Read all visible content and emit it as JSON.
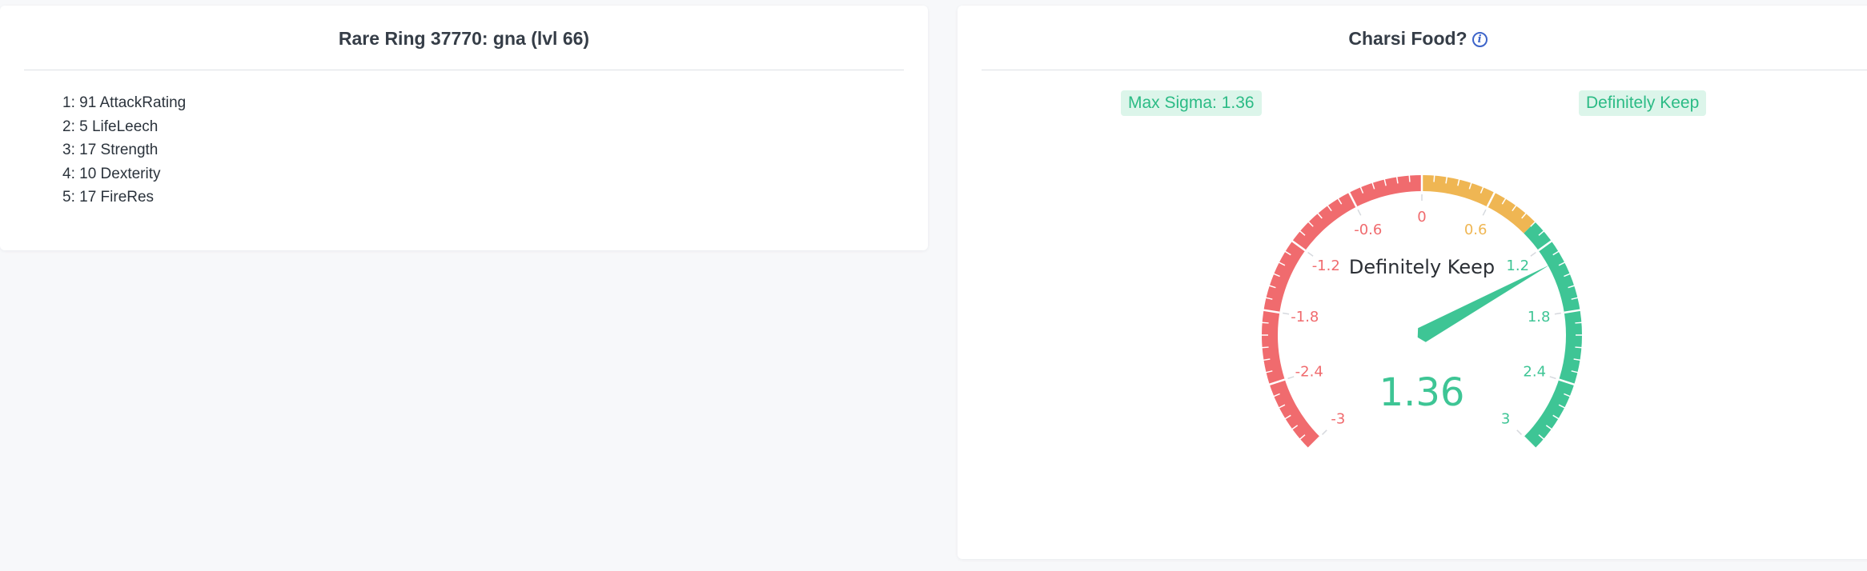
{
  "item": {
    "title": "Rare Ring 37770: gna (lvl 66)",
    "stats": [
      "1: 91 AttackRating",
      "2: 5 LifeLeech",
      "3: 17 Strength",
      "4: 10 Dexterity",
      "5: 17 FireRes"
    ]
  },
  "gauge_panel": {
    "title": "Charsi Food?",
    "info_icon": "info-circle-icon",
    "max_sigma_label": "Max Sigma: 1.36",
    "verdict_label": "Definitely Keep"
  },
  "gauge": {
    "min": -3,
    "max": 3,
    "value": 1.36,
    "value_text": "1.36",
    "center_label": "Definitely Keep",
    "ticks": [
      "-3",
      "-2.4",
      "-1.8",
      "-1.2",
      "-0.6",
      "0",
      "0.6",
      "1.2",
      "1.8",
      "2.4",
      "3"
    ],
    "bands": [
      {
        "from": -3,
        "to": 0,
        "color": "#f06b6e"
      },
      {
        "from": 0,
        "to": 1,
        "color": "#efb653"
      },
      {
        "from": 1,
        "to": 3,
        "color": "#3ec595"
      }
    ],
    "needle_color": "#3ec595",
    "value_color": "#3ec595"
  }
}
